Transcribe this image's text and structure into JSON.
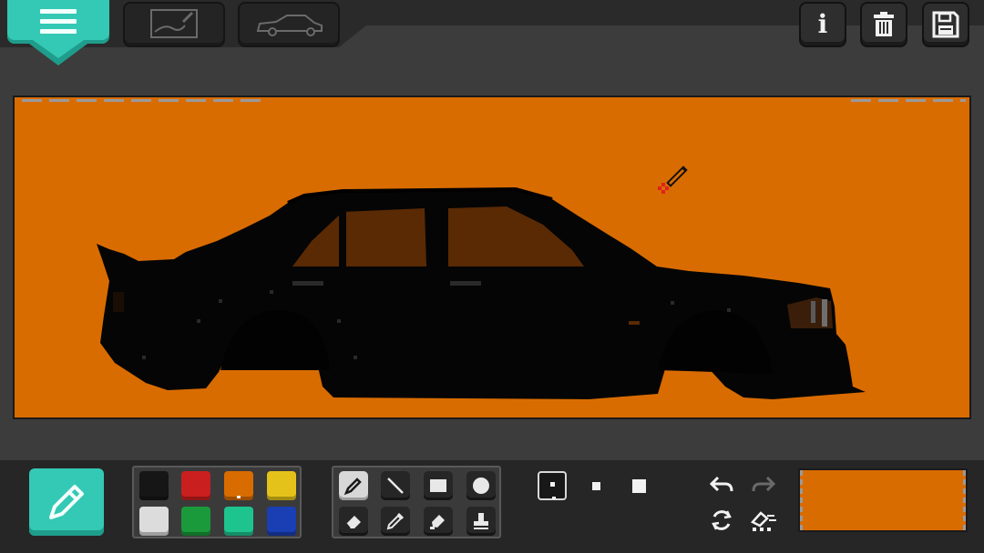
{
  "colors": {
    "accent": "#34c9b4",
    "canvas_background": "#d96c00",
    "car_body": "#050505",
    "car_window": "#5a2a04"
  },
  "top_bar": {
    "menu_button": {
      "icon": "hamburger-menu-icon"
    },
    "tabs": [
      {
        "id": "sketch",
        "icon": "sketch-pencil-icon"
      },
      {
        "id": "car",
        "icon": "car-outline-icon"
      }
    ],
    "info_button": {
      "icon": "info-icon",
      "glyph": "i"
    },
    "delete_button": {
      "icon": "trash-icon"
    },
    "save_button": {
      "icon": "floppy-disk-icon"
    }
  },
  "canvas": {
    "background_color": "#d96c00",
    "cursor_tool": "pencil-cursor-icon"
  },
  "bottom_bar": {
    "active_tool_button": {
      "icon": "pencil-icon"
    },
    "palette": [
      {
        "color": "#161616",
        "selected": false
      },
      {
        "color": "#c91f1f",
        "selected": false
      },
      {
        "color": "#d96c00",
        "selected": true
      },
      {
        "color": "#e4c21a",
        "selected": false
      },
      {
        "color": "#dcdcdc",
        "selected": false
      },
      {
        "color": "#1a9a3a",
        "selected": false
      },
      {
        "color": "#1ec48e",
        "selected": false
      },
      {
        "color": "#1a3fb4",
        "selected": false
      }
    ],
    "tools": [
      {
        "id": "pencil",
        "icon": "pencil-icon",
        "selected": true
      },
      {
        "id": "line",
        "icon": "line-icon",
        "selected": false
      },
      {
        "id": "rectangle",
        "icon": "rectangle-icon",
        "selected": false
      },
      {
        "id": "circle",
        "icon": "circle-icon",
        "selected": false
      },
      {
        "id": "eraser",
        "icon": "eraser-icon",
        "selected": false
      },
      {
        "id": "eyedropper",
        "icon": "eyedropper-icon",
        "selected": false
      },
      {
        "id": "fill",
        "icon": "paint-fill-icon",
        "selected": false
      },
      {
        "id": "stamp",
        "icon": "stamp-icon",
        "selected": false
      }
    ],
    "brush_sizes": [
      {
        "id": "small",
        "selected": true
      },
      {
        "id": "medium",
        "selected": false
      },
      {
        "id": "large",
        "selected": false
      }
    ],
    "actions": [
      {
        "id": "undo",
        "icon": "undo-icon",
        "enabled": true
      },
      {
        "id": "redo",
        "icon": "redo-icon",
        "enabled": false
      },
      {
        "id": "rotate",
        "icon": "rotate-icon",
        "enabled": true
      },
      {
        "id": "clear-layer",
        "icon": "eraser-dots-icon",
        "enabled": true
      }
    ],
    "preview": {
      "color": "#d96c00"
    }
  }
}
